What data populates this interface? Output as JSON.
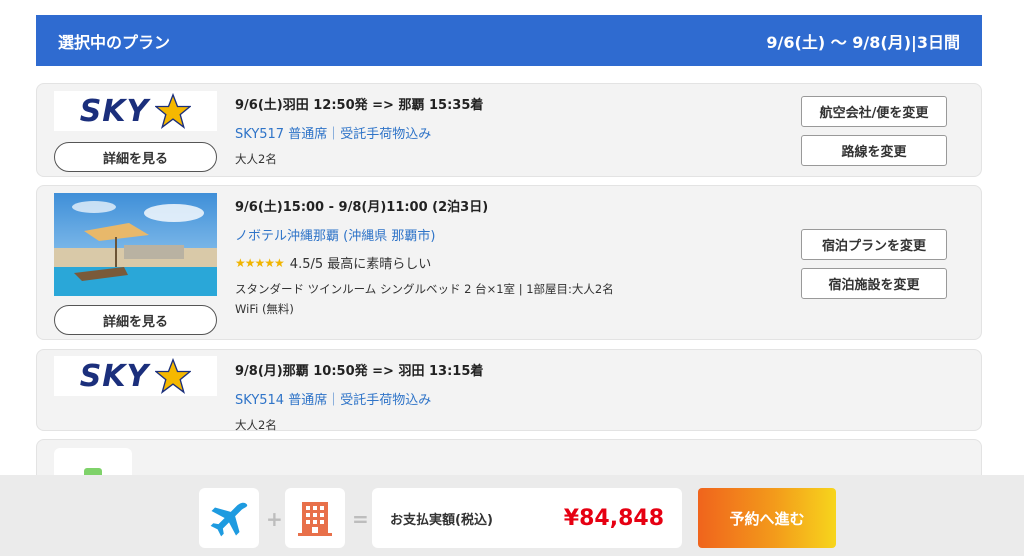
{
  "header": {
    "title": "選択中のプラン",
    "dates": "9/6(土) 〜 9/8(月)|3日間"
  },
  "outbound_flight": {
    "airline_logo_text": "SKY",
    "route": "9/6(土)羽田 12:50発 => 那覇 15:35着",
    "flight_info": "SKY517 普通席｜受託手荷物込み",
    "passengers": "大人2名",
    "detail_button": "詳細を見る",
    "change_airline_button": "航空会社/便を変更",
    "change_route_button": "路線を変更"
  },
  "hotel": {
    "stay": "9/6(土)15:00 - 9/8(月)11:00 (2泊3日)",
    "name": "ノボテル沖縄那覇 (沖縄県 那覇市)",
    "stars": "★★★★★",
    "rating": "4.5/5 最高に素晴らしい",
    "rating_value": 4.5,
    "room": "スタンダード ツインルーム シングルベッド 2 台×1室 | 1部屋目:大人2名",
    "amenity": "WiFi (無料)",
    "detail_button": "詳細を見る",
    "change_plan_button": "宿泊プランを変更",
    "change_hotel_button": "宿泊施設を変更"
  },
  "return_flight": {
    "airline_logo_text": "SKY",
    "route": "9/8(月)那覇 10:50発 => 羽田 13:15着",
    "flight_info": "SKY514 普通席｜受託手荷物込み",
    "passengers": "大人2名"
  },
  "footer": {
    "plus": "+",
    "equals": "=",
    "pay_label": "お支払実額(税込)",
    "pay_amount": "¥84,848",
    "reserve_button": "予約へ進む"
  },
  "colors": {
    "header": "#2f6bd0",
    "link": "#2f74c8",
    "price": "#e60012",
    "logo_navy": "#1b2f7c",
    "logo_gold": "#f5b800"
  },
  "icons": {
    "flight": "airplane-icon",
    "hotel": "building-icon"
  }
}
